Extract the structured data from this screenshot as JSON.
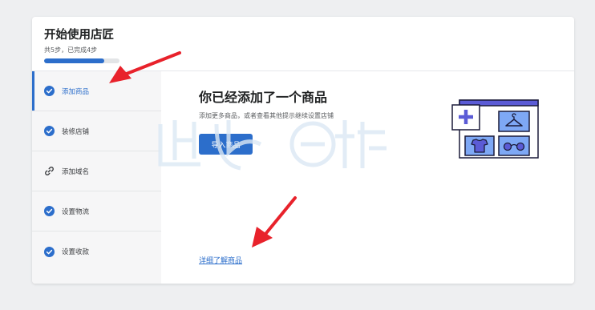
{
  "header": {
    "title": "开始使用店匠",
    "subtitle": "共5步，已完成4步",
    "progress": 0.8
  },
  "steps": [
    {
      "label": "添加商品",
      "icon": "check-circle-icon",
      "active": true
    },
    {
      "label": "装修店铺",
      "icon": "check-circle-icon",
      "active": false
    },
    {
      "label": "添加域名",
      "icon": "link-icon",
      "active": false
    },
    {
      "label": "设置物流",
      "icon": "check-circle-icon",
      "active": false
    },
    {
      "label": "设置收款",
      "icon": "check-circle-icon",
      "active": false
    }
  ],
  "content": {
    "heading": "你已经添加了一个商品",
    "description": "添加更多商品，或者查看其他提示继续设置店铺",
    "button_label": "导入商品",
    "link_label": "详细了解商品"
  },
  "colors": {
    "accent": "#2c6ecb",
    "annotation_arrow": "#e8222b"
  }
}
